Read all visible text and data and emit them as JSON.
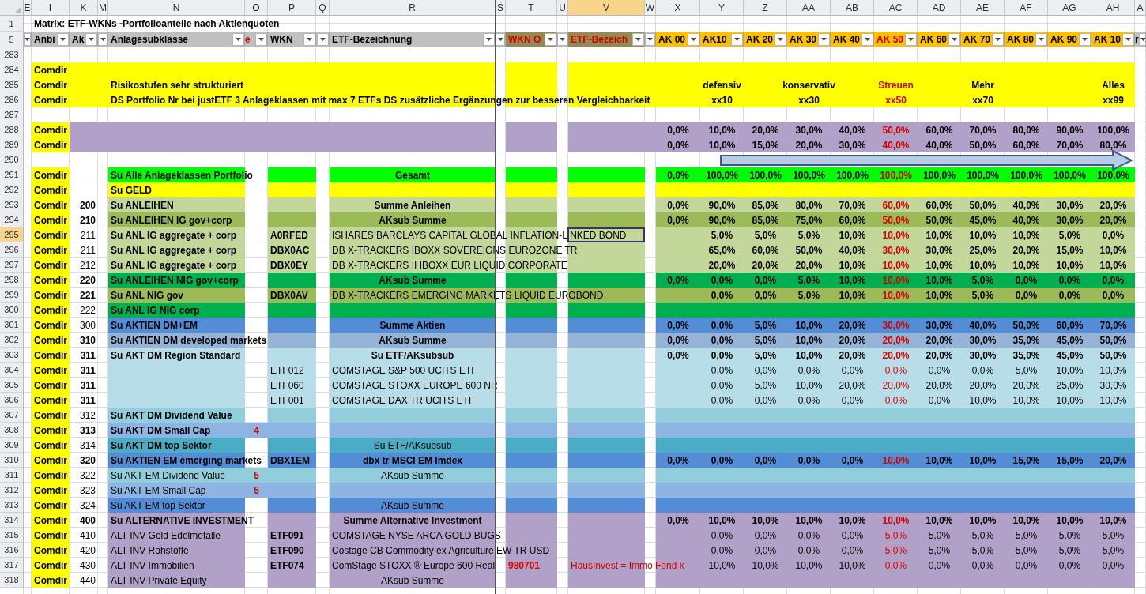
{
  "columns": [
    {
      "letter": "E",
      "selected": false
    },
    {
      "letter": "I",
      "selected": false
    },
    {
      "letter": "K",
      "selected": false
    },
    {
      "letter": "M",
      "selected": false
    },
    {
      "letter": "N",
      "selected": false
    },
    {
      "letter": "O",
      "selected": false
    },
    {
      "letter": "P",
      "selected": false
    },
    {
      "letter": "Q",
      "selected": false
    },
    {
      "letter": "R",
      "selected": false
    },
    {
      "letter": "S",
      "selected": false
    },
    {
      "letter": "T",
      "selected": false
    },
    {
      "letter": "U",
      "selected": false
    },
    {
      "letter": "V",
      "selected": true
    },
    {
      "letter": "W",
      "selected": false
    },
    {
      "letter": "X",
      "selected": false
    },
    {
      "letter": "Y",
      "selected": false
    },
    {
      "letter": "Z",
      "selected": false
    },
    {
      "letter": "AA",
      "selected": false
    },
    {
      "letter": "AB",
      "selected": false
    },
    {
      "letter": "AC",
      "selected": false
    },
    {
      "letter": "AD",
      "selected": false
    },
    {
      "letter": "AE",
      "selected": false
    },
    {
      "letter": "AF",
      "selected": false
    },
    {
      "letter": "AG",
      "selected": false
    },
    {
      "letter": "AH",
      "selected": false
    },
    {
      "letter": "A",
      "selected": false
    }
  ],
  "title_row": {
    "number": "1",
    "text": "Matrix: ETF-WKNs -Portfolioanteile nach Aktienquoten"
  },
  "header_row": {
    "number": "5",
    "filters": [
      {
        "color": "#c0c0c0"
      },
      {
        "label": "Anbi",
        "color": "#c0c0c0",
        "alert": false
      },
      {
        "label": "Ak",
        "color": "#c0c0c0",
        "alert": false
      },
      {
        "color": "#c0c0c0"
      },
      {
        "label": "Anlagesubklasse",
        "color": "#c0c0c0",
        "alert": false
      },
      {
        "label": "e",
        "color": "#c0c0c0",
        "alert": true
      },
      {
        "label": "WKN",
        "color": "#c0c0c0",
        "alert": false
      },
      {
        "color": "#c0c0c0"
      },
      {
        "label": "ETF-Bezeichnung",
        "color": "#c0c0c0",
        "alert": false
      },
      {
        "color": "#c0c0c0"
      },
      {
        "label": "WKN O",
        "color": "#948a54",
        "alert": true
      },
      {
        "color": "#c0c0c0"
      },
      {
        "label": "ETF-Bezeich",
        "color": "#948a54",
        "alert": true
      },
      {
        "color": "#c0c0c0"
      },
      {
        "label": "AK 00",
        "color": "#ffc000",
        "alert": false
      },
      {
        "label": "AK10",
        "color": "#ffc000",
        "alert": false
      },
      {
        "label": "AK 20",
        "color": "#ffc000",
        "alert": false
      },
      {
        "label": "AK 30",
        "color": "#ffc000",
        "alert": false
      },
      {
        "label": "AK 40",
        "color": "#ffc000",
        "alert": false
      },
      {
        "label": "AK 50",
        "color": "#ffc000",
        "alert": true
      },
      {
        "label": "AK 60",
        "color": "#ffc000",
        "alert": false
      },
      {
        "label": "AK 70",
        "color": "#ffc000",
        "alert": false
      },
      {
        "label": "AK 80",
        "color": "#ffc000",
        "alert": false
      },
      {
        "label": "AK 90",
        "color": "#ffc000",
        "alert": false
      },
      {
        "label": "AK 10",
        "color": "#ffc000",
        "alert": false
      },
      {
        "label": "r",
        "color": "#c0c0c0",
        "alert": false
      }
    ]
  },
  "rows": [
    {
      "number": "283",
      "kind": "blank",
      "selected": false
    },
    {
      "number": "284",
      "kind": "banner",
      "selected": false,
      "color": "#ffff00",
      "provider": "Comdir"
    },
    {
      "number": "285",
      "kind": "banner",
      "selected": false,
      "color": "#ffff00",
      "provider": "Comdir",
      "label": "Risikostufen sehr strukturiert",
      "headings": [
        "defensiv",
        "konservativ",
        "Streuen",
        "Mehr",
        "Alles"
      ]
    },
    {
      "number": "286",
      "kind": "banner",
      "selected": false,
      "color": "#ffff00",
      "provider": "Comdir",
      "label": "DS Portfolio Nr bei justETF  3 Anlageklassen mit max 7 ETFs DS zusätzliche Ergänzungen zur besseren Vergleichbarkeit",
      "headings": [
        "xx10",
        "xx30",
        "xx50",
        "xx70",
        "xx99"
      ]
    },
    {
      "number": "287",
      "kind": "blank",
      "selected": false
    },
    {
      "number": "288",
      "kind": "banner",
      "selected": false,
      "color": "#b1a0c7",
      "provider": "Comdir",
      "total": "0,0%",
      "values": [
        "10,0%",
        "20,0%",
        "30,0%",
        "40,0%",
        "50,0%",
        "60,0%",
        "70,0%",
        "80,0%",
        "90,0%",
        "100,0%"
      ]
    },
    {
      "number": "289",
      "kind": "banner",
      "selected": false,
      "color": "#b1a0c7",
      "provider": "Comdir",
      "total": "0,0%",
      "values": [
        "10,0%",
        "15,0%",
        "20,0%",
        "30,0%",
        "40,0%",
        "40,0%",
        "50,0%",
        "60,0%",
        "70,0%",
        "80,0%"
      ]
    },
    {
      "number": "290",
      "kind": "arrow",
      "selected": false
    },
    {
      "number": "291",
      "kind": "item",
      "selected": false,
      "color": "#00ff00",
      "provider": "Comdir",
      "label": "Su Alle Anlageklassen Portfolio",
      "label_bold": true,
      "name": "Gesamt",
      "name_bold": true,
      "name_centered": true,
      "total": "0,0%",
      "values": [
        "100,0%",
        "100,0%",
        "100,0%",
        "100,0%",
        "100,0%",
        "100,0%",
        "100,0%",
        "100,0%",
        "100,0%",
        "100,0%"
      ],
      "values_bold": true
    },
    {
      "number": "292",
      "kind": "item",
      "selected": false,
      "color": "#ffff00",
      "provider": "Comdir",
      "label": "Su GELD",
      "label_bold": true
    },
    {
      "number": "293",
      "kind": "item",
      "selected": false,
      "color": "#c4d79b",
      "provider": "Comdir",
      "code": "200",
      "code_bold": true,
      "label": "Su ANLEIHEN",
      "label_bold": true,
      "name": "Summe Anleihen",
      "name_bold": true,
      "name_centered": true,
      "total": "0,0%",
      "values": [
        "90,0%",
        "85,0%",
        "80,0%",
        "70,0%",
        "60,0%",
        "60,0%",
        "50,0%",
        "40,0%",
        "30,0%",
        "20,0%"
      ],
      "values_bold": true
    },
    {
      "number": "294",
      "kind": "item",
      "selected": false,
      "color": "#9bbb59",
      "provider": "Comdir",
      "code": "210",
      "code_bold": true,
      "label": "Su ANLEIHEN IG gov+corp",
      "label_bold": true,
      "name": "AKsub Summe",
      "name_bold": true,
      "name_centered": true,
      "total": "0,0%",
      "values": [
        "90,0%",
        "85,0%",
        "75,0%",
        "60,0%",
        "50,0%",
        "50,0%",
        "45,0%",
        "40,0%",
        "30,0%",
        "20,0%"
      ],
      "values_bold": true
    },
    {
      "number": "295",
      "kind": "item",
      "selected": true,
      "color": "#c4d79b",
      "provider": "Comdir",
      "code": "211",
      "code_bold": false,
      "label": "Su ANL IG aggregate + corp",
      "label_bold": true,
      "wkn": "A0RFED",
      "wkn_bold": true,
      "name": "ISHARES BARCLAYS CAPITAL GLOBAL INFLATION-LINKED BOND",
      "name_bold": false,
      "name_centered": false,
      "values": [
        "5,0%",
        "5,0%",
        "5,0%",
        "10,0%",
        "10,0%",
        "10,0%",
        "10,0%",
        "10,0%",
        "5,0%",
        "0,0%"
      ],
      "values_bold": true
    },
    {
      "number": "296",
      "kind": "item",
      "selected": false,
      "color": "#c4d79b",
      "provider": "Comdir",
      "code": "211",
      "code_bold": false,
      "label": "Su ANL IG aggregate + corp",
      "label_bold": true,
      "wkn": "DBX0AC",
      "wkn_bold": true,
      "name": "DB X-TRACKERS IBOXX SOVEREIGNS EUROZONE TR",
      "name_bold": false,
      "name_centered": false,
      "values": [
        "65,0%",
        "60,0%",
        "50,0%",
        "40,0%",
        "30,0%",
        "30,0%",
        "25,0%",
        "20,0%",
        "15,0%",
        "10,0%"
      ],
      "values_bold": true
    },
    {
      "number": "297",
      "kind": "item",
      "selected": false,
      "color": "#c4d79b",
      "provider": "Comdir",
      "code": "212",
      "code_bold": false,
      "label": "Su ANL IG aggregate + corp",
      "label_bold": true,
      "wkn": "DBX0EY",
      "wkn_bold": true,
      "name": "DB X-TRACKERS II IBOXX EUR LIQUID CORPORATE",
      "name_bold": false,
      "name_centered": false,
      "values": [
        "20,0%",
        "20,0%",
        "20,0%",
        "10,0%",
        "10,0%",
        "10,0%",
        "10,0%",
        "10,0%",
        "10,0%",
        "10,0%"
      ],
      "values_bold": true
    },
    {
      "number": "298",
      "kind": "item",
      "selected": false,
      "color": "#00b050",
      "provider": "Comdir",
      "code": "220",
      "code_bold": true,
      "label": "Su ANLEIHEN NIG gov+corp",
      "label_bold": true,
      "name": "AKsub Summe",
      "name_bold": true,
      "name_centered": true,
      "total": "0,0%",
      "values": [
        "0,0%",
        "0,0%",
        "5,0%",
        "10,0%",
        "10,0%",
        "10,0%",
        "5,0%",
        "0,0%",
        "0,0%",
        "0,0%"
      ],
      "values_bold": true
    },
    {
      "number": "299",
      "kind": "item",
      "selected": false,
      "color": "#9bbb59",
      "provider": "Comdir",
      "code": "221",
      "code_bold": true,
      "label": "Su ANL NIG gov",
      "label_bold": true,
      "wkn": "DBX0AV",
      "wkn_bold": true,
      "name": "DB X-TRACKERS EMERGING MARKETS LIQUID EUROBOND",
      "name_bold": false,
      "name_centered": false,
      "values": [
        "0,0%",
        "0,0%",
        "5,0%",
        "10,0%",
        "10,0%",
        "10,0%",
        "5,0%",
        "0,0%",
        "0,0%",
        "0,0%"
      ],
      "values_bold": true
    },
    {
      "number": "300",
      "kind": "item",
      "selected": false,
      "color": "#00b050",
      "provider": "Comdir",
      "code": "222",
      "code_bold": false,
      "label": "Su ANL IG NIG corp",
      "label_bold": true
    },
    {
      "number": "301",
      "kind": "item",
      "selected": false,
      "color": "#538dd5",
      "provider": "Comdir",
      "code": "300",
      "code_bold": false,
      "label": "Su AKTIEN DM+EM",
      "label_bold": true,
      "name": "Summe Aktien",
      "name_bold": true,
      "name_centered": true,
      "total": "0,0%",
      "values": [
        "0,0%",
        "5,0%",
        "10,0%",
        "20,0%",
        "30,0%",
        "30,0%",
        "40,0%",
        "50,0%",
        "60,0%",
        "70,0%"
      ],
      "values_bold": true
    },
    {
      "number": "302",
      "kind": "item",
      "selected": false,
      "color": "#95b3d7",
      "provider": "Comdir",
      "code": "310",
      "code_bold": true,
      "label": "Su AKTIEN DM developed markets",
      "label_bold": true,
      "name": "AKsub Summe",
      "name_bold": true,
      "name_centered": true,
      "total": "0,0%",
      "values": [
        "0,0%",
        "5,0%",
        "10,0%",
        "20,0%",
        "20,0%",
        "20,0%",
        "30,0%",
        "35,0%",
        "45,0%",
        "50,0%"
      ],
      "values_bold": true
    },
    {
      "number": "303",
      "kind": "item",
      "selected": false,
      "color": "#b7dee8",
      "provider": "Comdir",
      "code": "311",
      "code_bold": true,
      "label": "Su AKT DM Region Standard",
      "label_bold": true,
      "name": "Su ETF/AKsubsub",
      "name_bold": true,
      "name_centered": true,
      "total": "0,0%",
      "values": [
        "0,0%",
        "5,0%",
        "10,0%",
        "20,0%",
        "20,0%",
        "20,0%",
        "30,0%",
        "35,0%",
        "45,0%",
        "50,0%"
      ],
      "values_bold": true
    },
    {
      "number": "304",
      "kind": "item",
      "selected": false,
      "color": "#b7dee8",
      "provider": "Comdir",
      "code": "311",
      "code_bold": true,
      "wkn": "ETF012",
      "wkn_bold": false,
      "name": "COMSTAGE S&P 500 UCITS ETF",
      "name_bold": false,
      "name_centered": false,
      "values": [
        "0,0%",
        "0,0%",
        "0,0%",
        "0,0%",
        "0,0%",
        "0,0%",
        "0,0%",
        "5,0%",
        "10,0%",
        "10,0%"
      ],
      "values_bold": false
    },
    {
      "number": "305",
      "kind": "item",
      "selected": false,
      "color": "#b7dee8",
      "provider": "Comdir",
      "code": "311",
      "code_bold": true,
      "wkn": "ETF060",
      "wkn_bold": false,
      "name": "COMSTAGE STOXX EUROPE 600 NR",
      "name_bold": false,
      "name_centered": false,
      "values": [
        "0,0%",
        "5,0%",
        "10,0%",
        "20,0%",
        "20,0%",
        "20,0%",
        "20,0%",
        "20,0%",
        "25,0%",
        "30,0%"
      ],
      "values_bold": false
    },
    {
      "number": "306",
      "kind": "item",
      "selected": false,
      "color": "#b7dee8",
      "provider": "Comdir",
      "code": "311",
      "code_bold": true,
      "wkn": "ETF001",
      "wkn_bold": false,
      "name": "COMSTAGE DAX TR UCITS ETF",
      "name_bold": false,
      "name_centered": false,
      "values": [
        "0,0%",
        "0,0%",
        "0,0%",
        "0,0%",
        "0,0%",
        "0,0%",
        "10,0%",
        "10,0%",
        "10,0%",
        "10,0%"
      ],
      "values_bold": false
    },
    {
      "number": "307",
      "kind": "item",
      "selected": false,
      "color": "#92cddc",
      "provider": "Comdir",
      "code": "312",
      "code_bold": false,
      "label": "Su AKT DM Dividend Value",
      "label_bold": true
    },
    {
      "number": "308",
      "kind": "item",
      "selected": false,
      "color": "#8db4e2",
      "provider": "Comdir",
      "code": "313",
      "code_bold": true,
      "label": "Su AKT DM Small Cap",
      "label_bold": true,
      "mark": "4"
    },
    {
      "number": "309",
      "kind": "item",
      "selected": false,
      "color": "#4bacc6",
      "provider": "Comdir",
      "code": "314",
      "code_bold": false,
      "label": "Su AKT DM top Sektor",
      "label_bold": true,
      "name": "Su ETF/AKsubsub",
      "name_bold": false,
      "name_centered": true
    },
    {
      "number": "310",
      "kind": "item",
      "selected": false,
      "color": "#538dd5",
      "provider": "Comdir",
      "code": "320",
      "code_bold": true,
      "label": "Su AKTIEN EM emerging markets",
      "label_bold": true,
      "wkn": "DBX1EM",
      "wkn_bold": true,
      "name": "dbx tr MSCI EM Imdex",
      "name_bold": true,
      "name_centered": true,
      "total": "0,0%",
      "values": [
        "0,0%",
        "0,0%",
        "0,0%",
        "0,0%",
        "10,0%",
        "10,0%",
        "10,0%",
        "15,0%",
        "15,0%",
        "20,0%"
      ],
      "values_bold": true
    },
    {
      "number": "311",
      "kind": "item",
      "selected": false,
      "color": "#92cddc",
      "provider": "Comdir",
      "code": "322",
      "code_bold": false,
      "label": "Su AKT EM Dividend Value",
      "label_bold": false,
      "mark": "5",
      "name": "AKsub Summe",
      "name_bold": false,
      "name_centered": true
    },
    {
      "number": "312",
      "kind": "item",
      "selected": false,
      "color": "#8db4e2",
      "provider": "Comdir",
      "code": "323",
      "code_bold": false,
      "label": "Su AKT EM Small Cap",
      "label_bold": false,
      "mark": "5"
    },
    {
      "number": "313",
      "kind": "item",
      "selected": false,
      "color": "#538dd5",
      "provider": "Comdir",
      "code": "324",
      "code_bold": false,
      "label": "Su AKT EM top Sektor",
      "label_bold": false,
      "name": "AKsub Summe",
      "name_bold": false,
      "name_centered": true
    },
    {
      "number": "314",
      "kind": "item",
      "selected": false,
      "color": "#b1a0c7",
      "provider": "Comdir",
      "code": "400",
      "code_bold": true,
      "label": "Su ALTERNATIVE INVESTMENT",
      "label_bold": true,
      "name": "Summe Alternative Investment",
      "name_bold": true,
      "name_centered": true,
      "total": "0,0%",
      "values": [
        "10,0%",
        "10,0%",
        "10,0%",
        "10,0%",
        "10,0%",
        "10,0%",
        "10,0%",
        "10,0%",
        "10,0%",
        "10,0%"
      ],
      "values_bold": true
    },
    {
      "number": "315",
      "kind": "item",
      "selected": false,
      "color": "#b1a0c7",
      "provider": "Comdir",
      "code": "410",
      "code_bold": false,
      "label": "ALT INV Gold Edelmetalle",
      "label_bold": false,
      "wkn": "ETF091",
      "wkn_bold": true,
      "name": "COMSTAGE NYSE ARCA GOLD BUGS",
      "name_bold": false,
      "name_centered": false,
      "values": [
        "0,0%",
        "0,0%",
        "0,0%",
        "0,0%",
        "5,0%",
        "5,0%",
        "5,0%",
        "5,0%",
        "5,0%",
        "5,0%"
      ],
      "values_bold": false
    },
    {
      "number": "316",
      "kind": "item",
      "selected": false,
      "color": "#b1a0c7",
      "provider": "Comdir",
      "code": "420",
      "code_bold": false,
      "label": "ALT INV Rohstoffe",
      "label_bold": false,
      "wkn": "ETF090",
      "wkn_bold": true,
      "name": "Costage CB Commodity ex Agriculture EW TR USD",
      "name_bold": false,
      "name_centered": false,
      "values": [
        "0,0%",
        "0,0%",
        "0,0%",
        "0,0%",
        "5,0%",
        "5,0%",
        "5,0%",
        "5,0%",
        "5,0%",
        "5,0%"
      ],
      "values_bold": false
    },
    {
      "number": "317",
      "kind": "item",
      "selected": false,
      "color": "#b1a0c7",
      "provider": "Comdir",
      "code": "430",
      "code_bold": false,
      "label": "ALT INV Immobilien",
      "label_bold": false,
      "wkn": "ETF074",
      "wkn_bold": true,
      "name": "ComStage STOXX ® Europe 600 Real",
      "name_bold": false,
      "name_centered": false,
      "t_text": "980701",
      "v_text": "HausInvest = Immo Fond k",
      "values": [
        "10,0%",
        "10,0%",
        "10,0%",
        "10,0%",
        "0,0%",
        "0,0%",
        "0,0%",
        "0,0%",
        "0,0%",
        "0,0%"
      ],
      "values_bold": false
    },
    {
      "number": "318",
      "kind": "item",
      "selected": false,
      "color": "#b1a0c7",
      "provider": "Comdir",
      "code": "440",
      "code_bold": false,
      "label": "ALT INV Private Equity",
      "label_bold": false,
      "name": "AKsub Summe",
      "name_bold": false,
      "name_centered": true
    }
  ]
}
